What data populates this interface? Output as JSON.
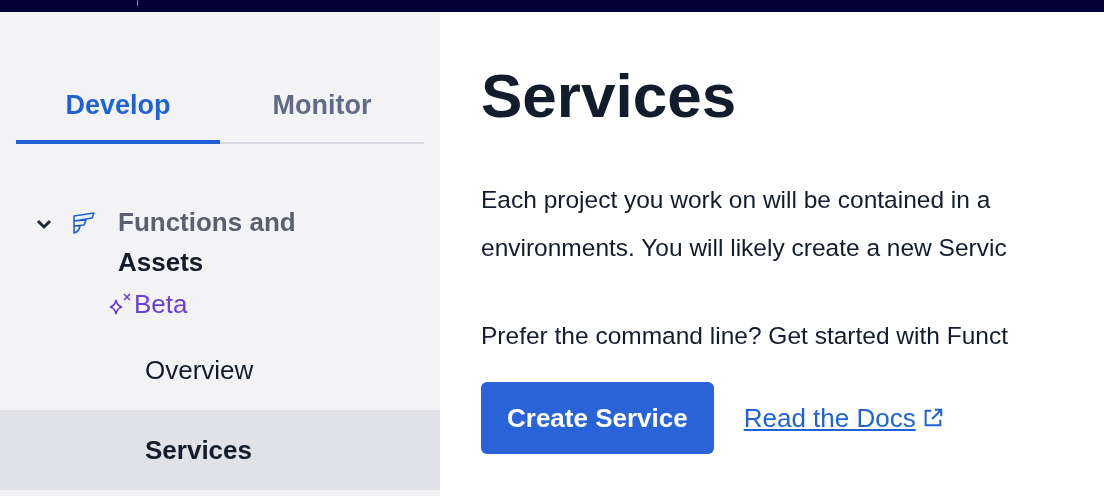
{
  "tabs": [
    {
      "label": "Develop",
      "selected": true
    },
    {
      "label": "Monitor",
      "selected": false
    }
  ],
  "sidebar": {
    "items": [
      {
        "label": "Functions and",
        "label_2": "Assets",
        "badge": "Beta",
        "expanded": true,
        "children": [
          {
            "label": "Overview",
            "selected": false
          },
          {
            "label": "Services",
            "selected": true
          }
        ]
      }
    ]
  },
  "main": {
    "title": "Services",
    "paragraphs": [
      [
        "Each project you work on will be contained in a",
        "environments. You will likely create a new Servic"
      ],
      [
        "Prefer the command line? Get started with Funct"
      ]
    ],
    "primary_button": "Create Service",
    "docs_link": "Read the Docs"
  }
}
